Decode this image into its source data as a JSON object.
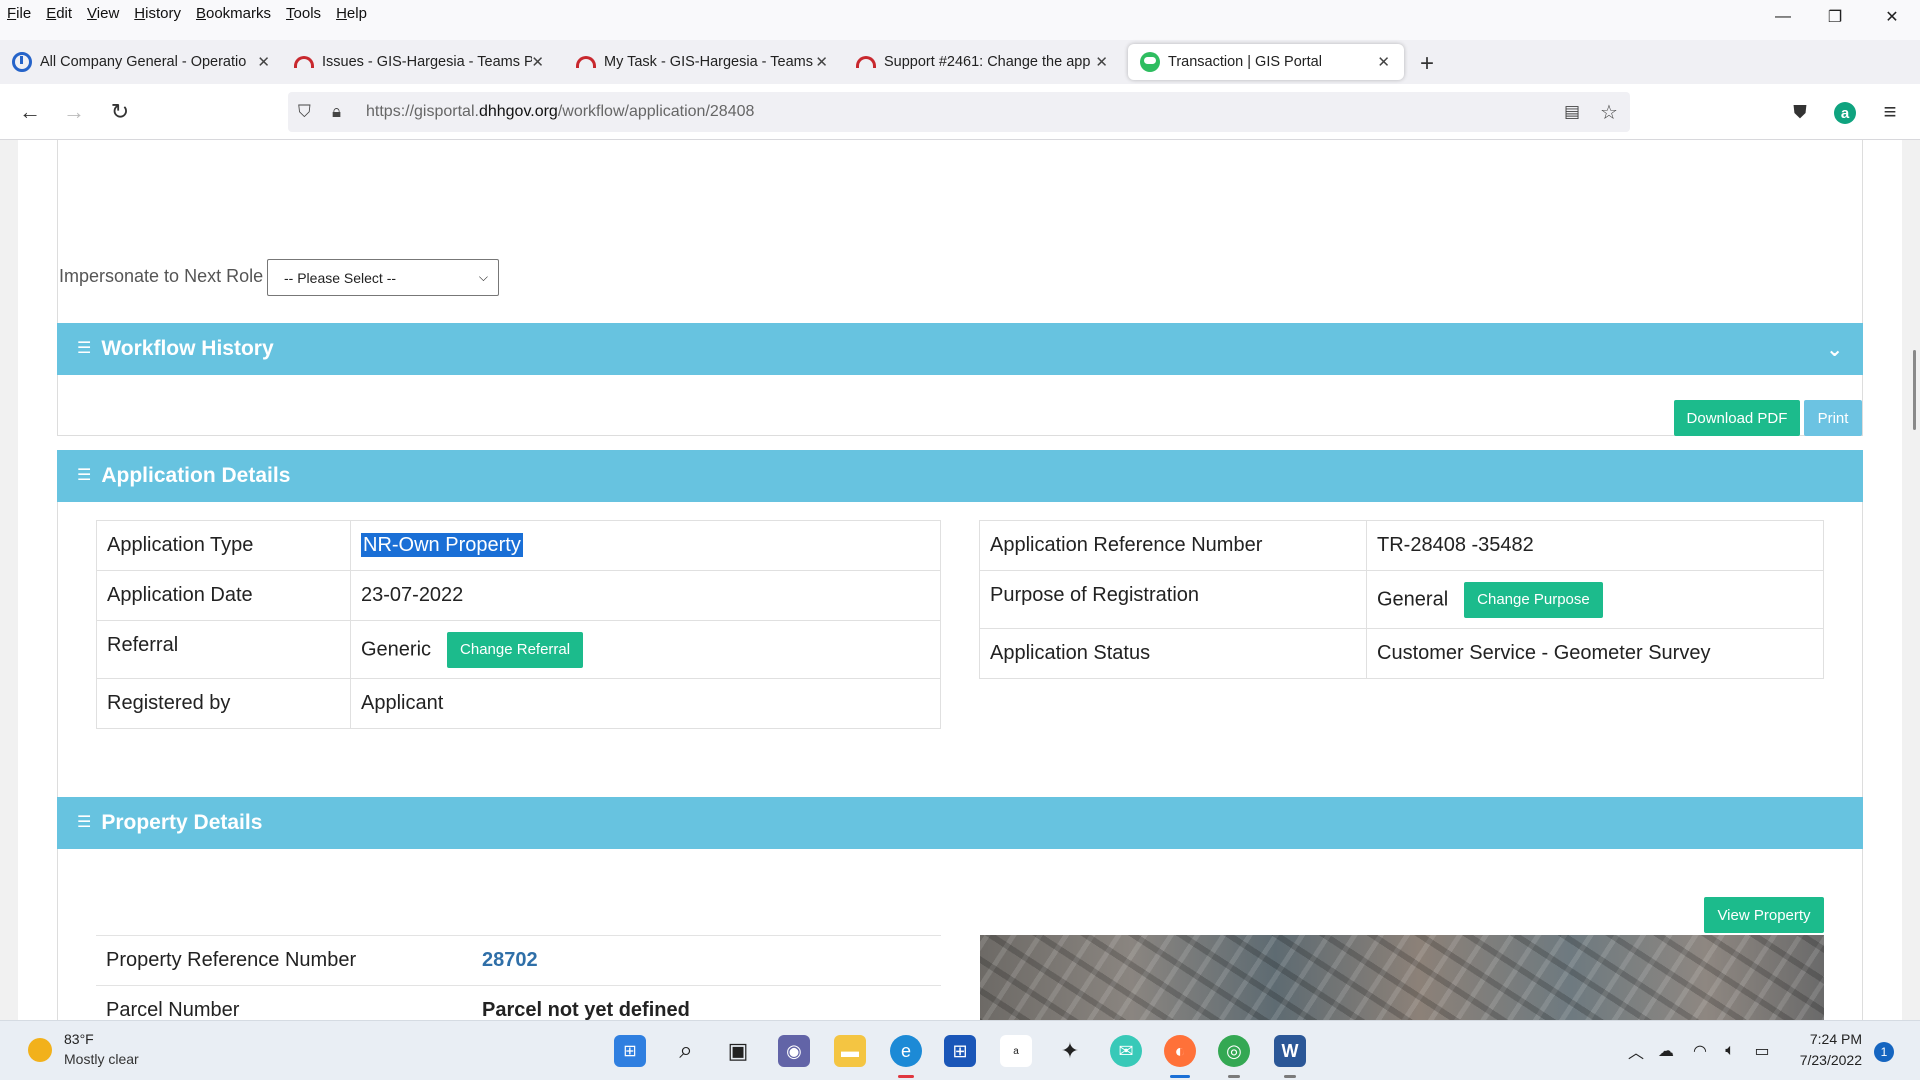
{
  "menu": [
    "File",
    "Edit",
    "View",
    "History",
    "Bookmarks",
    "Tools",
    "Help"
  ],
  "window_controls": {
    "minimize": "—",
    "restore": "❐",
    "close": "✕"
  },
  "tabs": [
    {
      "title": "All Company General - Operatio",
      "icon": "teams-icon"
    },
    {
      "title": "Issues - GIS-Hargesia - Teams P",
      "icon": "redmine-icon"
    },
    {
      "title": "My Task - GIS-Hargesia - Teams",
      "icon": "redmine-icon"
    },
    {
      "title": "Support #2461: Change the app",
      "icon": "redmine-icon"
    },
    {
      "title": "Transaction | GIS Portal",
      "icon": "portal-icon"
    }
  ],
  "address": {
    "prefix": "https://gisportal.",
    "domain": "dhhgov.org",
    "path": "/workflow/application/28408"
  },
  "impersonate": {
    "label": "Impersonate to Next Role",
    "selected": "-- Please Select --"
  },
  "workflow_history": {
    "title": "Workflow History"
  },
  "actions": {
    "download_pdf": "Download PDF",
    "print": "Print"
  },
  "application_details": {
    "title": "Application Details",
    "left": {
      "type_label": "Application Type",
      "type_value": "NR-Own Property",
      "date_label": "Application Date",
      "date_value": "23-07-2022",
      "referral_label": "Referral",
      "referral_value": "Generic",
      "referral_btn": "Change Referral",
      "registered_label": "Registered by",
      "registered_value": "Applicant"
    },
    "right": {
      "ref_label": "Application Reference Number",
      "ref_value": "TR-28408 -35482",
      "purpose_label": "Purpose of Registration",
      "purpose_value": "General",
      "purpose_btn": "Change Purpose",
      "status_label": "Application Status",
      "status_value": "Customer Service - Geometer Survey"
    }
  },
  "property_details": {
    "title": "Property Details",
    "view_btn": "View Property",
    "ref_label": "Property Reference Number",
    "ref_value": "28702",
    "parcel_label": "Parcel Number",
    "parcel_value": "Parcel not yet defined"
  },
  "taskbar": {
    "weather_temp": "83°F",
    "weather_desc": "Mostly clear",
    "time": "7:24 PM",
    "date": "7/23/2022",
    "notifications": "1"
  },
  "colors": {
    "panel_header": "#67c3e0",
    "button_green": "#1cbb8c",
    "selection": "#1a6fd6"
  }
}
